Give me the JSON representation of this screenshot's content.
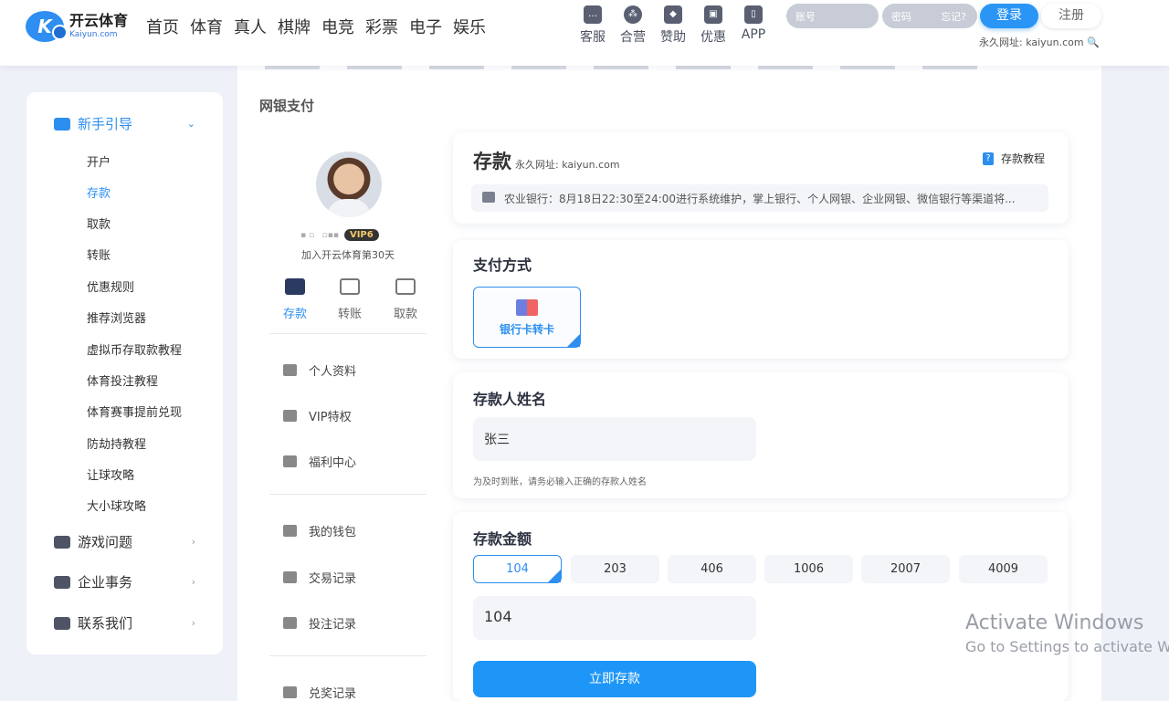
{
  "header": {
    "logo_cn": "开云体育",
    "logo_en": "Kaiyun.com",
    "nav": [
      "首页",
      "体育",
      "真人",
      "棋牌",
      "电竞",
      "彩票",
      "电子",
      "娱乐"
    ],
    "tools": [
      "客服",
      "合营",
      "赞助",
      "优惠",
      "APP"
    ],
    "account_placeholder": "账号",
    "password_placeholder": "密码",
    "forgot_label": "忘记?",
    "login_label": "登录",
    "register_label": "注册",
    "permanent_url": "永久网址: kaiyun.com"
  },
  "sidebar": {
    "section1": "新手引导",
    "items": [
      "开户",
      "存款",
      "取款",
      "转账",
      "优惠规则",
      "推荐浏览器",
      "虚拟币存取款教程",
      "体育投注教程",
      "体育赛事提前兑现",
      "防劫持教程",
      "让球攻略",
      "大小球攻略"
    ],
    "section2": "游戏问题",
    "section3": "企业事务",
    "section4": "联系我们"
  },
  "page": {
    "title": "网银支付"
  },
  "profile": {
    "vip": "VIP6",
    "joined": "加入开云体育第30天",
    "quick": [
      "存款",
      "转账",
      "取款"
    ],
    "menu": [
      "个人资料",
      "VIP特权",
      "福利中心",
      "我的钱包",
      "交易记录",
      "投注记录",
      "兑奖记录"
    ]
  },
  "deposit": {
    "title": "存款",
    "url": "永久网址: kaiyun.com",
    "tutorial": "存款教程",
    "notice": "农业银行：8月18日22:30至24:00进行系统维护，掌上银行、个人网银、企业网银、微信银行等渠道将..."
  },
  "payment": {
    "title": "支付方式",
    "option": "银行卡转卡"
  },
  "name_section": {
    "title": "存款人姓名",
    "value": "张三",
    "hint": "为及时到账，请务必输入正确的存款人姓名"
  },
  "amount_section": {
    "title": "存款金额",
    "options": [
      "104",
      "203",
      "406",
      "1006",
      "2007",
      "4009"
    ],
    "value": "104",
    "submit": "立即存款"
  },
  "watermark": {
    "line1": "Activate Windows",
    "line2": "Go to Settings to activate Windows."
  }
}
